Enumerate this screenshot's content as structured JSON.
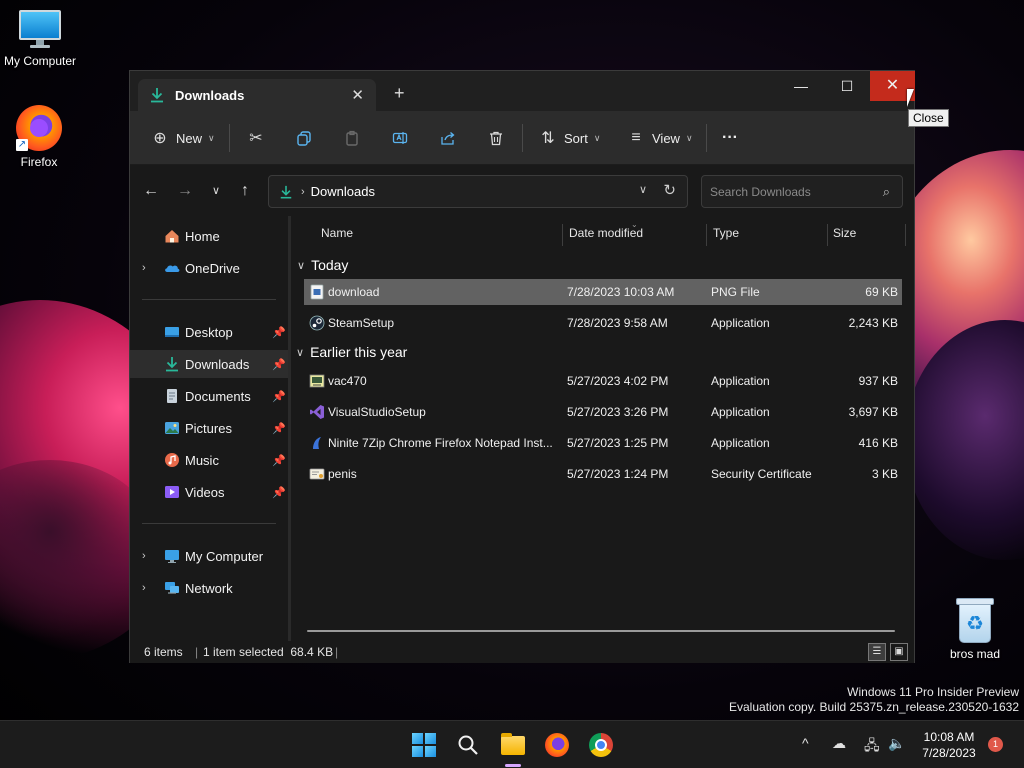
{
  "desktop": {
    "icons": [
      {
        "label": "My Computer",
        "icon": "monitor-icon"
      },
      {
        "label": "Firefox",
        "icon": "firefox-icon"
      },
      {
        "label": "bros mad",
        "icon": "recycle-bin-icon"
      }
    ],
    "watermark": {
      "line1": "Windows 11 Pro Insider Preview",
      "line2": "Evaluation copy. Build 25375.zn_release.230520-1632"
    }
  },
  "window": {
    "tab_title": "Downloads",
    "tooltip": "Close",
    "accent": "#c42b1c"
  },
  "toolbar": {
    "new_label": "New",
    "sort_label": "Sort",
    "view_label": "View",
    "more_label": "···"
  },
  "address": {
    "path": "Downloads",
    "search_placeholder": "Search Downloads"
  },
  "sidebar": {
    "items": [
      {
        "label": "Home",
        "icon": "home-icon"
      },
      {
        "label": "OneDrive",
        "icon": "onedrive-icon"
      },
      {
        "label": "Desktop",
        "icon": "desktop-icon"
      },
      {
        "label": "Downloads",
        "icon": "downloads-icon"
      },
      {
        "label": "Documents",
        "icon": "documents-icon"
      },
      {
        "label": "Pictures",
        "icon": "pictures-icon"
      },
      {
        "label": "Music",
        "icon": "music-icon"
      },
      {
        "label": "Videos",
        "icon": "videos-icon"
      },
      {
        "label": "My Computer",
        "icon": "monitor-icon"
      },
      {
        "label": "Network",
        "icon": "network-icon"
      }
    ]
  },
  "columns": {
    "name": "Name",
    "date": "Date modified",
    "type": "Type",
    "size": "Size"
  },
  "groups": [
    {
      "label": "Today",
      "files": [
        {
          "name": "download",
          "date": "7/28/2023 10:03 AM",
          "type": "PNG File",
          "size": "69 KB",
          "selected": true
        },
        {
          "name": "SteamSetup",
          "date": "7/28/2023 9:58 AM",
          "type": "Application",
          "size": "2,243 KB"
        }
      ]
    },
    {
      "label": "Earlier this year",
      "files": [
        {
          "name": "vac470",
          "date": "5/27/2023 4:02 PM",
          "type": "Application",
          "size": "937 KB"
        },
        {
          "name": "VisualStudioSetup",
          "date": "5/27/2023 3:26 PM",
          "type": "Application",
          "size": "3,697 KB"
        },
        {
          "name": "Ninite 7Zip Chrome Firefox Notepad Inst...",
          "date": "5/27/2023 1:25 PM",
          "type": "Application",
          "size": "416 KB"
        },
        {
          "name": "penis",
          "date": "5/27/2023 1:24 PM",
          "type": "Security Certificate",
          "size": "3 KB"
        }
      ]
    }
  ],
  "status": {
    "count": "6 items",
    "selection": "1 item selected  68.4 KB"
  },
  "taskbar": {
    "time": "10:08 AM",
    "date": "7/28/2023",
    "notifications": "1"
  }
}
